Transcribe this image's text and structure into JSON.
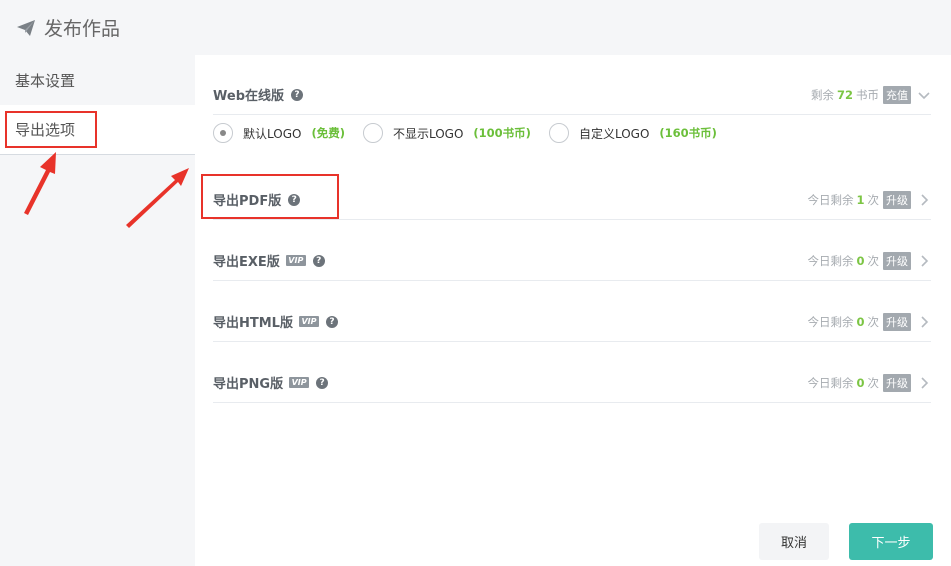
{
  "window": {
    "title": "发布作品"
  },
  "sidebar": {
    "items": [
      {
        "label": "基本设置"
      },
      {
        "label": "导出选项"
      }
    ]
  },
  "web": {
    "label": "Web在线版",
    "remain_prefix": "剩余",
    "remain_value": "72",
    "remain_unit": "书币",
    "recharge": "充值",
    "options": [
      {
        "label": "默认LOGO",
        "price": "(免费)",
        "selected": true
      },
      {
        "label": "不显示LOGO",
        "price": "(100书币)",
        "selected": false
      },
      {
        "label": "自定义LOGO",
        "price": "(160书币)",
        "selected": false
      }
    ]
  },
  "exports": [
    {
      "label": "导出PDF版",
      "vip": false,
      "remain_prefix": "今日剩余",
      "count": "1",
      "unit": "次",
      "upgrade": "升级"
    },
    {
      "label": "导出EXE版",
      "vip": true,
      "remain_prefix": "今日剩余",
      "count": "0",
      "unit": "次",
      "upgrade": "升级"
    },
    {
      "label": "导出HTML版",
      "vip": true,
      "remain_prefix": "今日剩余",
      "count": "0",
      "unit": "次",
      "upgrade": "升级"
    },
    {
      "label": "导出PNG版",
      "vip": true,
      "remain_prefix": "今日剩余",
      "count": "0",
      "unit": "次",
      "upgrade": "升级"
    }
  ],
  "vip_badge": "VIP",
  "help_glyph": "?",
  "buttons": {
    "cancel": "取消",
    "next": "下一步"
  },
  "colors": {
    "accent": "#3dbcab",
    "price": "#6bbf3a",
    "annotation": "#e8332a"
  }
}
